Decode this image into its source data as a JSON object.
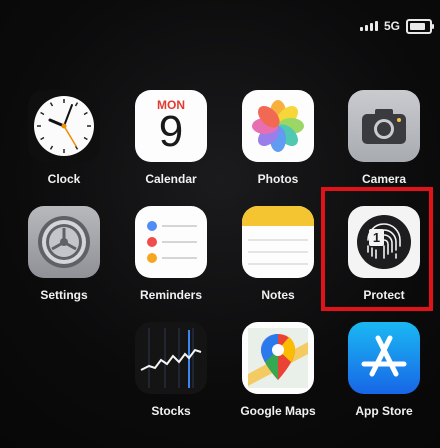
{
  "status_bar": {
    "network": "5G"
  },
  "apps": [
    {
      "name": "Clock",
      "label": "Clock",
      "icon": "clock-icon"
    },
    {
      "name": "Calendar",
      "label": "Calendar",
      "icon": "calendar-icon",
      "day": "MON",
      "date": "9"
    },
    {
      "name": "Photos",
      "label": "Photos",
      "icon": "photos-icon"
    },
    {
      "name": "Camera",
      "label": "Camera",
      "icon": "camera-icon"
    },
    {
      "name": "Settings",
      "label": "Settings",
      "icon": "settings-icon"
    },
    {
      "name": "Reminders",
      "label": "Reminders",
      "icon": "reminders-icon"
    },
    {
      "name": "Notes",
      "label": "Notes",
      "icon": "notes-icon"
    },
    {
      "name": "Protect",
      "label": "Protect",
      "icon": "fingerprint-icon",
      "badge": "1"
    },
    {
      "name": "Stocks",
      "label": "Stocks",
      "icon": "stocks-icon"
    },
    {
      "name": "Google Maps",
      "label": "Google Maps",
      "icon": "map-pin-icon"
    },
    {
      "name": "App Store",
      "label": "App Store",
      "icon": "app-store-icon"
    }
  ],
  "highlight": {
    "target": "Protect",
    "color": "#e21219"
  },
  "colors": {
    "background": "#0b0b0c",
    "label_text": "#f1f1f1",
    "calendar_red": "#e33b30",
    "notes_yellow": "#f4c531",
    "app_store_blue": "#1a84f0"
  }
}
